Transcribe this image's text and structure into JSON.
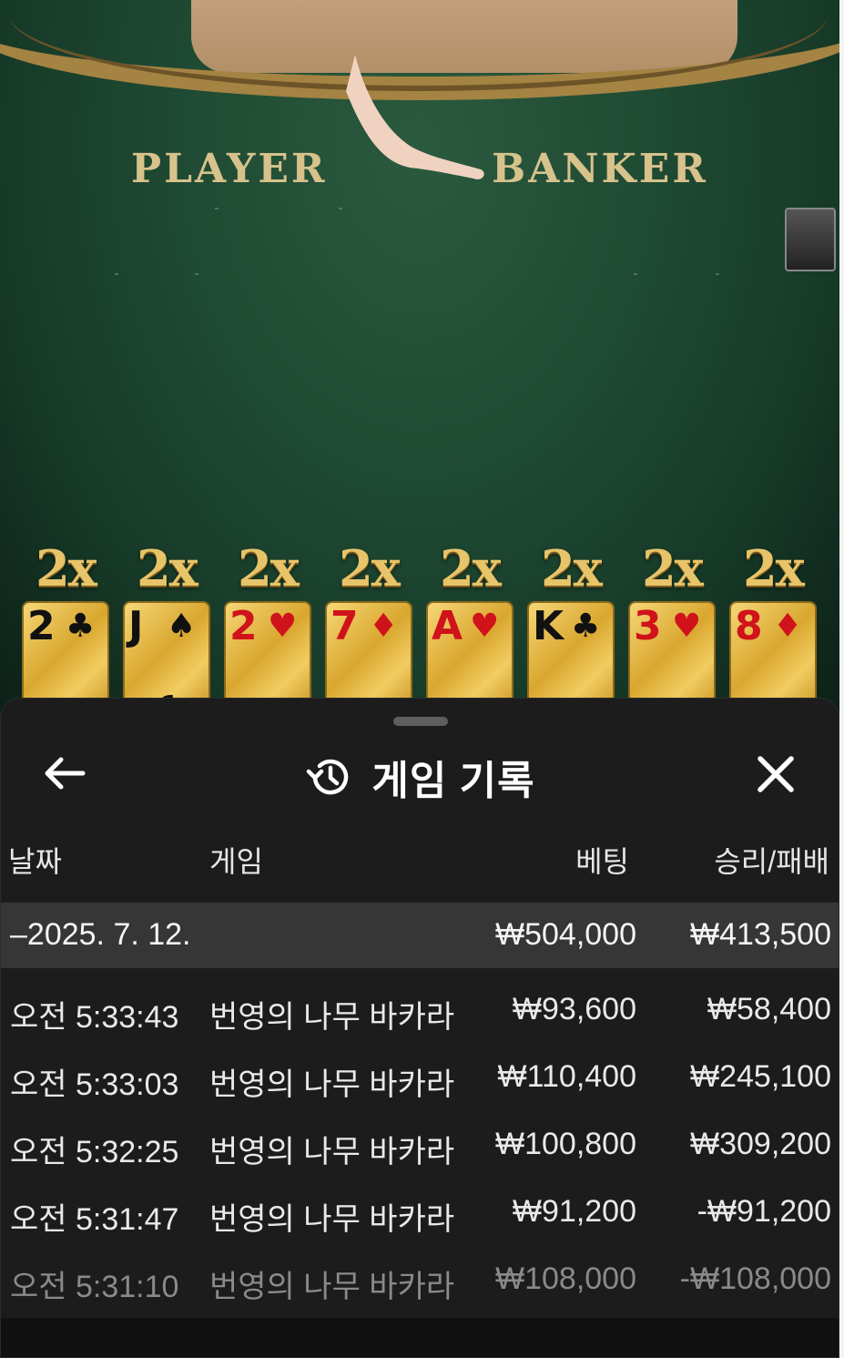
{
  "table": {
    "player_label": "PLAYER",
    "banker_label": "BANKER"
  },
  "cards": [
    {
      "mult": "2x",
      "rank": "2",
      "suit": "♣",
      "color": "black"
    },
    {
      "mult": "2x",
      "rank": "J",
      "suit": "♠",
      "color": "black"
    },
    {
      "mult": "2x",
      "rank": "2",
      "suit": "♥",
      "color": "red"
    },
    {
      "mult": "2x",
      "rank": "7",
      "suit": "♦",
      "color": "red"
    },
    {
      "mult": "2x",
      "rank": "A",
      "suit": "♥",
      "color": "red"
    },
    {
      "mult": "2x",
      "rank": "K",
      "suit": "♣",
      "color": "black"
    },
    {
      "mult": "2x",
      "rank": "3",
      "suit": "♥",
      "color": "red"
    },
    {
      "mult": "2x",
      "rank": "8",
      "suit": "♦",
      "color": "red"
    }
  ],
  "sheet": {
    "title": "게임 기록",
    "back_icon": "arrow-left-icon",
    "history_icon": "history-icon",
    "close_icon": "close-icon"
  },
  "columns": {
    "date": "날짜",
    "game": "게임",
    "bet": "베팅",
    "result": "승리/패배"
  },
  "summary": {
    "date": "–2025. 7. 12.",
    "bet": "₩504,000",
    "result": "₩413,500"
  },
  "rows": [
    {
      "time": "오전 5:33:43",
      "game": "번영의 나무 바카라",
      "bet": "₩93,600",
      "result": "₩58,400"
    },
    {
      "time": "오전 5:33:03",
      "game": "번영의 나무 바카라",
      "bet": "₩110,400",
      "result": "₩245,100"
    },
    {
      "time": "오전 5:32:25",
      "game": "번영의 나무 바카라",
      "bet": "₩100,800",
      "result": "₩309,200"
    },
    {
      "time": "오전 5:31:47",
      "game": "번영의 나무 바카라",
      "bet": "₩91,200",
      "result": "-₩91,200"
    },
    {
      "time": "오전 5:31:10",
      "game": "번영의 나무 바카라",
      "bet": "₩108,000",
      "result": "-₩108,000"
    }
  ],
  "colors": {
    "felt": "#1f4a33",
    "gold": "#e7c46a",
    "sheet_bg": "#1c1c1c",
    "summary_bg": "#363636"
  }
}
